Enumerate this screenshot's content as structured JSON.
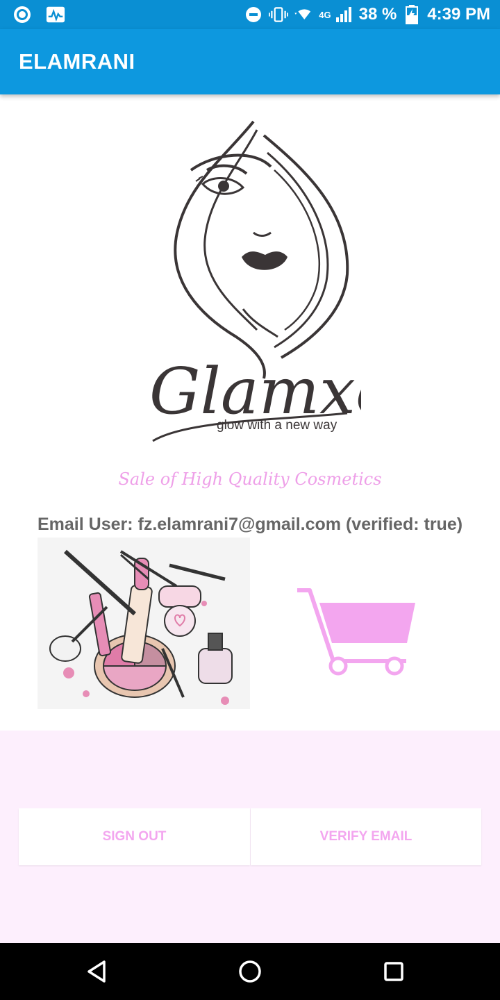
{
  "status_bar": {
    "network": "4G",
    "battery_percent": "38 %",
    "time": "4:39 PM"
  },
  "app_bar": {
    "title": "ELAMRANI"
  },
  "logo": {
    "brand": "Glamxo",
    "slogan": "glow with a new way"
  },
  "tagline": "Sale of High Quality Cosmetics",
  "user": {
    "email_line": "Email User: fz.elamrani7@gmail.com (verified: true)"
  },
  "buttons": {
    "sign_out": "SIGN OUT",
    "verify_email": "VERIFY EMAIL"
  },
  "colors": {
    "primary": "#0d98df",
    "accent_pink": "#f3a6ef",
    "panel_bg": "#fdeffd"
  },
  "icons": [
    "record-icon",
    "activity-icon",
    "dnd-icon",
    "vibrate-icon",
    "wifi-icon",
    "signal-icon",
    "battery-icon",
    "back-icon",
    "home-icon",
    "recents-icon",
    "cart-icon"
  ]
}
